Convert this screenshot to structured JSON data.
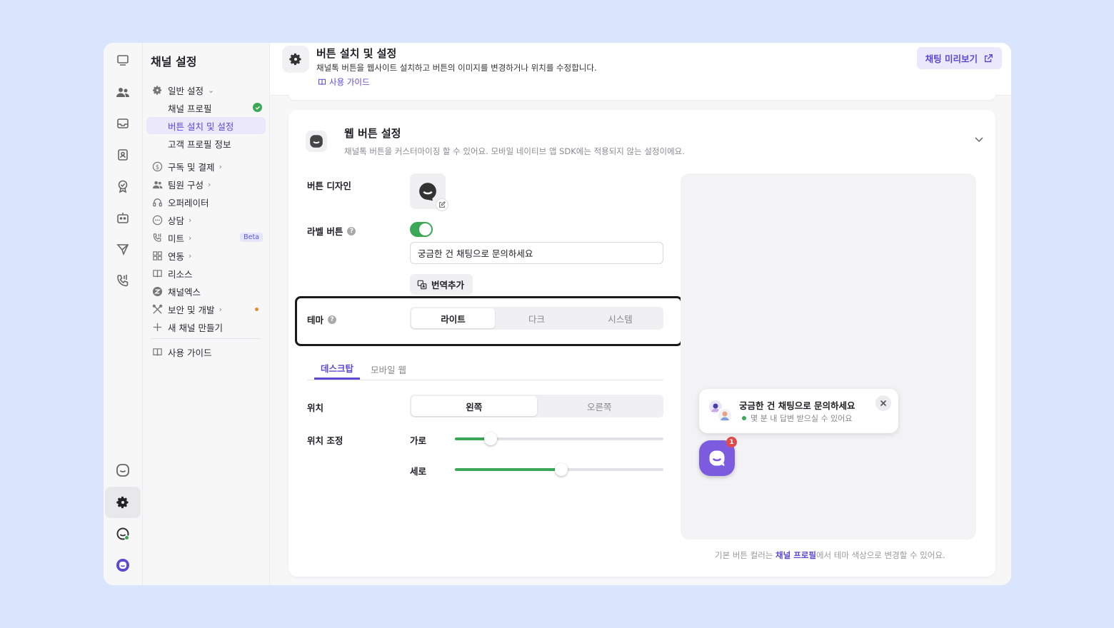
{
  "sidebar": {
    "title": "채널 설정",
    "items": [
      {
        "label": "일반 설정",
        "icon": "gear-icon",
        "chevron": "⌄"
      },
      {
        "label": "채널 프로필"
      },
      {
        "label": "버튼 설치 및 설정"
      },
      {
        "label": "고객 프로필 정보"
      },
      {
        "label": "구독 및 결제",
        "icon": "dollar-icon",
        "chevron": "›"
      },
      {
        "label": "팀원 구성",
        "icon": "team-icon",
        "chevron": "›"
      },
      {
        "label": "오퍼레이터",
        "icon": "headset-icon"
      },
      {
        "label": "상담",
        "icon": "chat-dots-icon",
        "chevron": "›"
      },
      {
        "label": "미트",
        "icon": "phone-icon",
        "chevron": "›",
        "badge": "Beta"
      },
      {
        "label": "연동",
        "icon": "grid-icon",
        "chevron": "›"
      },
      {
        "label": "리소스",
        "icon": "book-icon"
      },
      {
        "label": "채널엑스",
        "icon": "channelx-icon"
      },
      {
        "label": "보안 및 개발",
        "icon": "tools-icon",
        "chevron": "›"
      },
      {
        "label": "새 채널 만들기",
        "icon": "plus-icon"
      },
      {
        "label": "사용 가이드",
        "icon": "book-icon"
      }
    ]
  },
  "header": {
    "title": "버튼 설치 및 설정",
    "description": "채널톡 버튼을 웹사이트 설치하고 버튼의 이미지를 변경하거나 위치를 수정합니다.",
    "guide_link": "사용 가이드",
    "preview_button": "채팅 미리보기"
  },
  "card": {
    "title": "웹 버튼 설정",
    "description": "채널톡 버튼을 커스터마이징 할 수 있어요. 모바일 네이티브 앱 SDK에는 적용되지 않는 설정이에요.",
    "button_design_label": "버튼 디자인",
    "label_button_label": "라벨 버튼",
    "label_button_enabled": true,
    "label_text_value": "궁금한 건 채팅으로 문의하세요",
    "translate_button": "번역추가",
    "theme_label": "테마",
    "theme_options": [
      "라이트",
      "다크",
      "시스템"
    ],
    "theme_selected": "라이트",
    "tabs": [
      "데스크탑",
      "모바일 웹"
    ],
    "tab_selected": "데스크탑",
    "position_label": "위치",
    "position_options": [
      "왼쪽",
      "오른쪽"
    ],
    "position_selected": "왼쪽",
    "position_adjust_label": "위치 조정",
    "horizontal_label": "가로",
    "vertical_label": "세로",
    "horizontal_value": 0.17,
    "vertical_value": 0.51
  },
  "preview": {
    "bubble_title": "궁금한 건 채팅으로 문의하세요",
    "bubble_subtitle": "몇 분 내 답변 받으실 수 있어요",
    "badge_count": "1"
  },
  "footnote": {
    "prefix": "기본 버튼 컬러는 ",
    "link": "채널 프로필",
    "suffix": "에서 테마 색상으로 변경할 수 있어요."
  },
  "colors": {
    "accent": "#5a4ad1",
    "toggle_on": "#3aa856",
    "background": "#d9e5fd",
    "fab": "#7d5bde"
  }
}
